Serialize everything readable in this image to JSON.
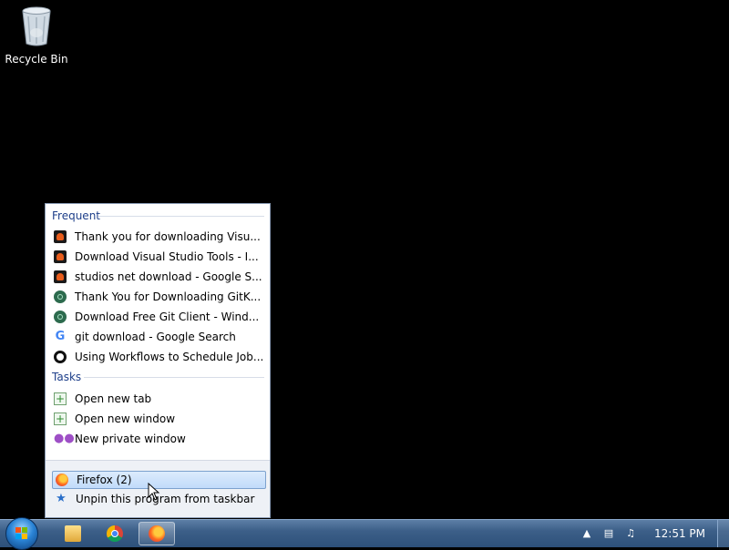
{
  "desktop": {
    "recycle_bin_label": "Recycle Bin"
  },
  "jumplist": {
    "frequent_header": "Frequent",
    "frequent_items": [
      {
        "label": "Thank you for downloading Visu...",
        "icon": "visual-studio-icon"
      },
      {
        "label": "Download Visual Studio Tools - I...",
        "icon": "visual-studio-icon"
      },
      {
        "label": "studios net download - Google S...",
        "icon": "visual-studio-icon"
      },
      {
        "label": "Thank You for Downloading GitK...",
        "icon": "gitkraken-icon"
      },
      {
        "label": "Download Free Git Client - Wind...",
        "icon": "gitkraken-icon"
      },
      {
        "label": "git download - Google Search",
        "icon": "google-icon"
      },
      {
        "label": "Using Workflows to Schedule Job...",
        "icon": "workflow-icon"
      }
    ],
    "tasks_header": "Tasks",
    "task_items": [
      {
        "label": "Open new tab",
        "icon": "new-tab-icon"
      },
      {
        "label": "Open new window",
        "icon": "new-window-icon"
      },
      {
        "label": "New private window",
        "icon": "private-mask-icon"
      }
    ],
    "pinned_program": "Firefox (2)",
    "unpin_label": "Unpin this program from taskbar"
  },
  "taskbar": {
    "buttons": [
      "windows-explorer",
      "google-chrome",
      "firefox"
    ],
    "active_button": "firefox",
    "clock": "12:51 PM"
  },
  "colors": {
    "section_header": "#1e3f8a",
    "taskbar": "#3c5f88",
    "highlight": "#c1dbfa"
  }
}
